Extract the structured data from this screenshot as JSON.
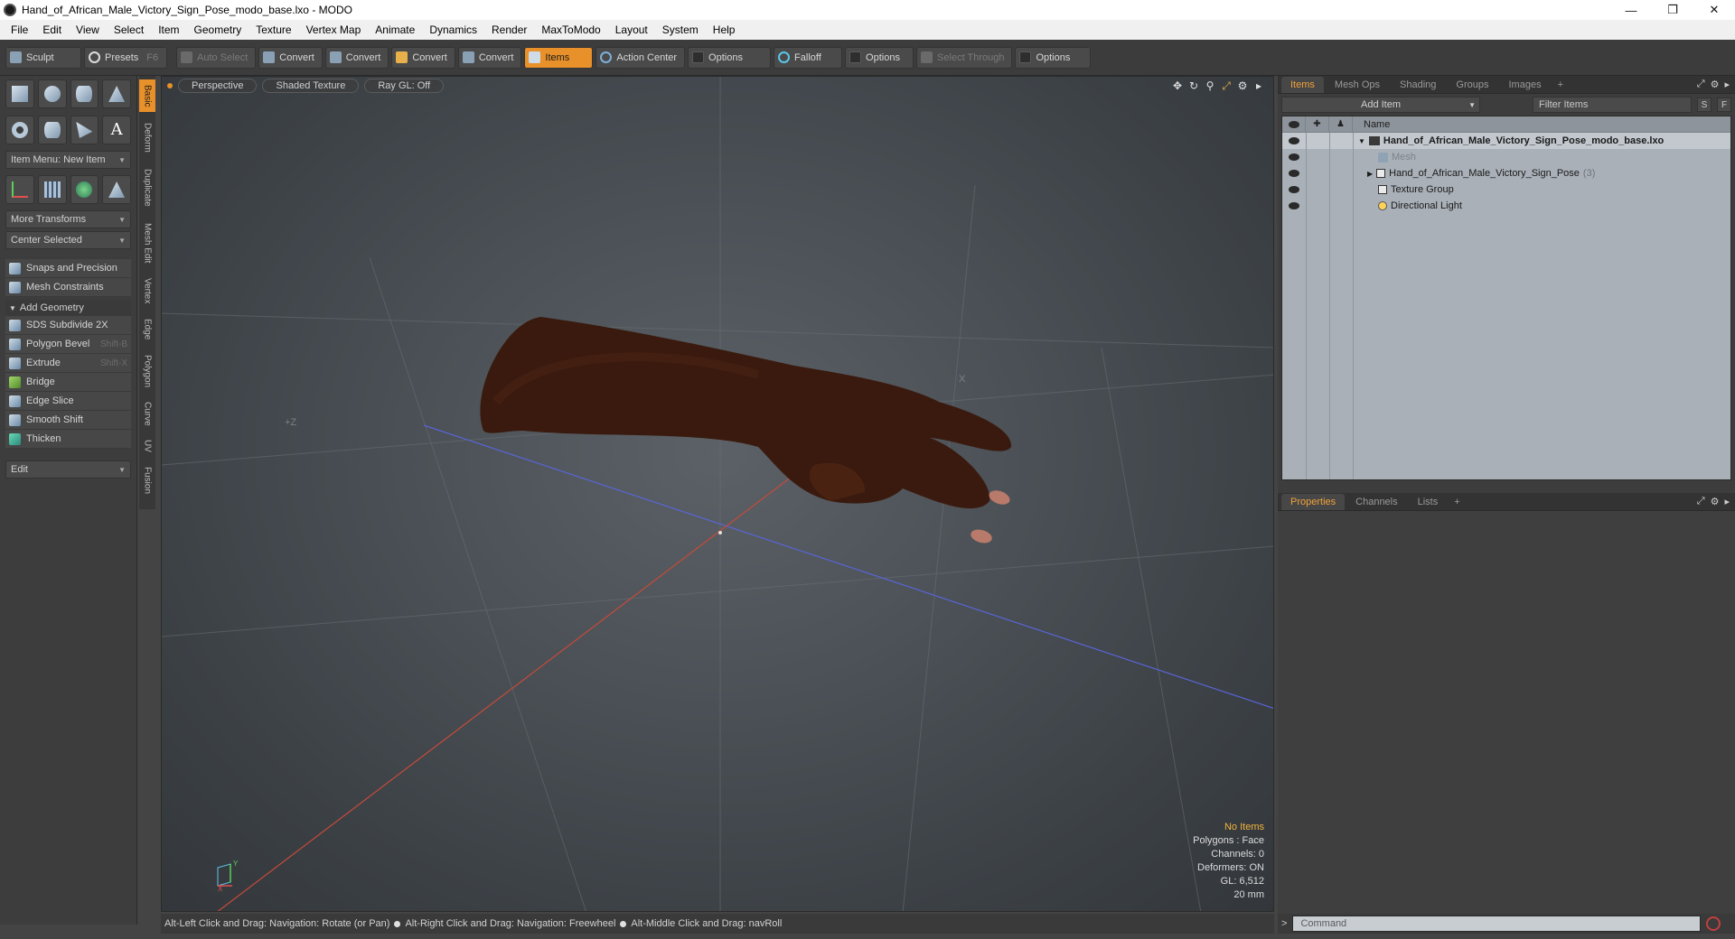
{
  "window": {
    "title": "Hand_of_African_Male_Victory_Sign_Pose_modo_base.lxo - MODO",
    "controls": [
      "—",
      "❐",
      "✕"
    ]
  },
  "menu": [
    "File",
    "Edit",
    "View",
    "Select",
    "Item",
    "Geometry",
    "Texture",
    "Vertex Map",
    "Animate",
    "Dynamics",
    "Render",
    "MaxToModo",
    "Layout",
    "System",
    "Help"
  ],
  "toolbar": {
    "sculpt": "Sculpt",
    "presets": "Presets",
    "presets_key": "F6",
    "auto_select": "Auto Select",
    "convert1": "Convert",
    "convert2": "Convert",
    "convert3": "Convert",
    "convert4": "Convert",
    "items": "Items",
    "action_center": "Action Center",
    "options1": "Options",
    "falloff": "Falloff",
    "options2": "Options",
    "select_through": "Select Through",
    "options3": "Options"
  },
  "toolbox": {
    "item_menu": "Item Menu: New Item",
    "more_transforms": "More Transforms",
    "center_selected": "Center Selected",
    "snaps": "Snaps and Precision",
    "mesh_constraints": "Mesh Constraints",
    "add_geometry": "Add Geometry",
    "tools": [
      {
        "label": "SDS Subdivide 2X",
        "key": ""
      },
      {
        "label": "Polygon Bevel",
        "key": "Shift-B"
      },
      {
        "label": "Extrude",
        "key": "Shift-X"
      },
      {
        "label": "Bridge",
        "key": ""
      },
      {
        "label": "Edge Slice",
        "key": ""
      },
      {
        "label": "Smooth Shift",
        "key": ""
      },
      {
        "label": "Thicken",
        "key": ""
      }
    ],
    "edit": "Edit",
    "vtabs": [
      "Basic",
      "Deform",
      "Duplicate",
      "Mesh Edit",
      "Vertex",
      "Edge",
      "Polygon",
      "Curve",
      "UV",
      "Fusion"
    ]
  },
  "viewport": {
    "view": "Perspective",
    "shading": "Shaded Texture",
    "raygl": "Ray GL: Off",
    "stats": {
      "selection": "No Items",
      "polygons": "Polygons : Face",
      "channels": "Channels: 0",
      "deformers": "Deformers: ON",
      "gl": "GL: 6,512",
      "scale": "20 mm"
    },
    "axis_labels": {
      "z_neg": "+Z",
      "x_far": "X",
      "gizmo_y": "Y",
      "gizmo_x": "X"
    }
  },
  "statusbar": {
    "hint1": "Alt-Left Click and Drag: Navigation: Rotate (or Pan)",
    "hint2": "Alt-Right Click and Drag: Navigation: Freewheel",
    "hint3": "Alt-Middle Click and Drag: navRoll"
  },
  "items_panel": {
    "tabs": [
      "Items",
      "Mesh Ops",
      "Shading",
      "Groups",
      "Images"
    ],
    "add_item": "Add Item",
    "filter": "Filter Items",
    "btn_s": "S",
    "btn_f": "F",
    "column_name": "Name",
    "rows": {
      "scene": "Hand_of_African_Male_Victory_Sign_Pose_modo_base.lxo",
      "mesh": "Mesh",
      "group": "Hand_of_African_Male_Victory_Sign_Pose",
      "group_count": "(3)",
      "texture_group": "Texture Group",
      "light": "Directional Light"
    }
  },
  "properties_panel": {
    "tabs": [
      "Properties",
      "Channels",
      "Lists"
    ]
  },
  "command": {
    "placeholder": "Command"
  },
  "colors": {
    "accent": "#e8902a",
    "skin": "#3a1a0e",
    "axis_x": "#c84a3a",
    "axis_z": "#5a64d8"
  }
}
